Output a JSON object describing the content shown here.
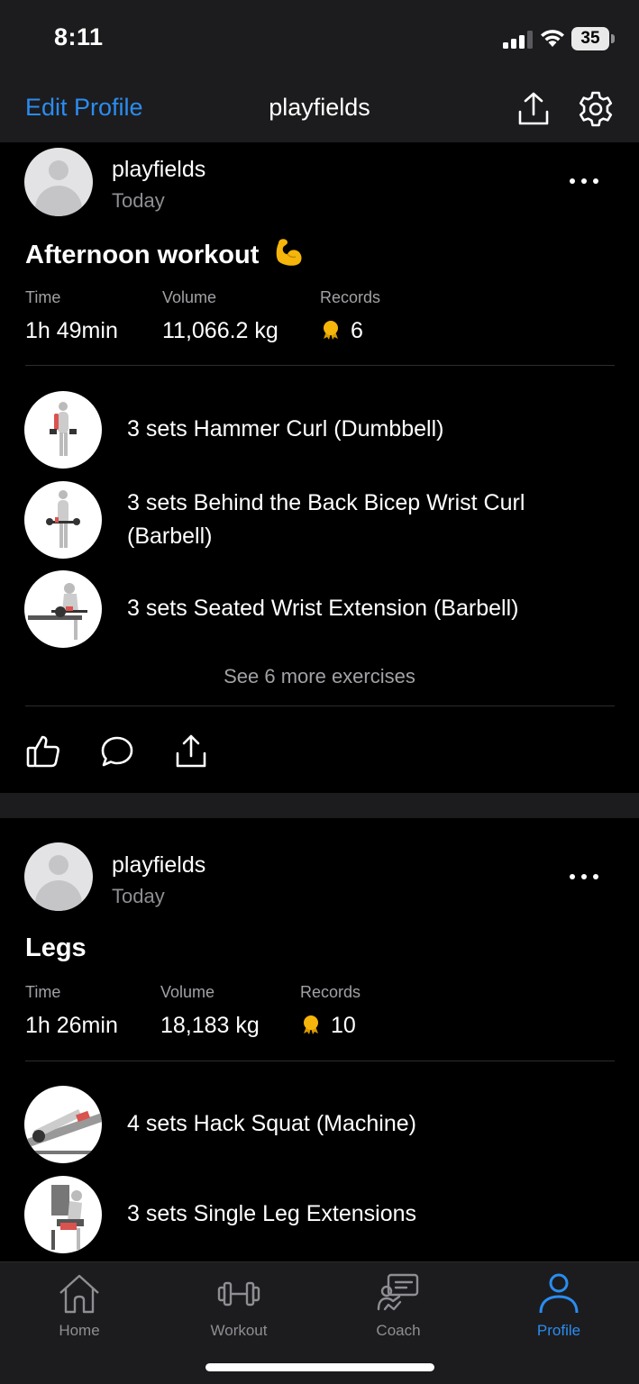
{
  "status_bar": {
    "time": "8:11",
    "battery": "35"
  },
  "header": {
    "edit_profile": "Edit Profile",
    "title": "playfields"
  },
  "posts": [
    {
      "username": "playfields",
      "date": "Today",
      "title": "Afternoon workout",
      "title_emoji": "💪",
      "stats": {
        "time_label": "Time",
        "time_value": "1h 49min",
        "volume_label": "Volume",
        "volume_value": "11,066.2 kg",
        "records_label": "Records",
        "records_value": "6"
      },
      "exercises": [
        {
          "text": "3 sets Hammer Curl (Dumbbell)"
        },
        {
          "text": "3 sets Behind the Back Bicep Wrist Curl (Barbell)"
        },
        {
          "text": "3 sets Seated Wrist Extension (Barbell)"
        }
      ],
      "see_more": "See 6 more exercises"
    },
    {
      "username": "playfields",
      "date": "Today",
      "title": "Legs",
      "stats": {
        "time_label": "Time",
        "time_value": "1h 26min",
        "volume_label": "Volume",
        "volume_value": "18,183 kg",
        "records_label": "Records",
        "records_value": "10"
      },
      "exercises": [
        {
          "text": "4 sets Hack Squat (Machine)"
        },
        {
          "text": "3 sets Single Leg Extensions"
        }
      ]
    }
  ],
  "tabbar": {
    "items": [
      {
        "label": "Home",
        "icon": "home-icon"
      },
      {
        "label": "Workout",
        "icon": "dumbbell-icon"
      },
      {
        "label": "Coach",
        "icon": "coach-icon"
      },
      {
        "label": "Profile",
        "icon": "person-icon",
        "active": true
      }
    ]
  },
  "colors": {
    "accent": "#2b8cf0",
    "background": "#000000",
    "surface": "#1c1c1e",
    "medal": "#f5b50a"
  }
}
